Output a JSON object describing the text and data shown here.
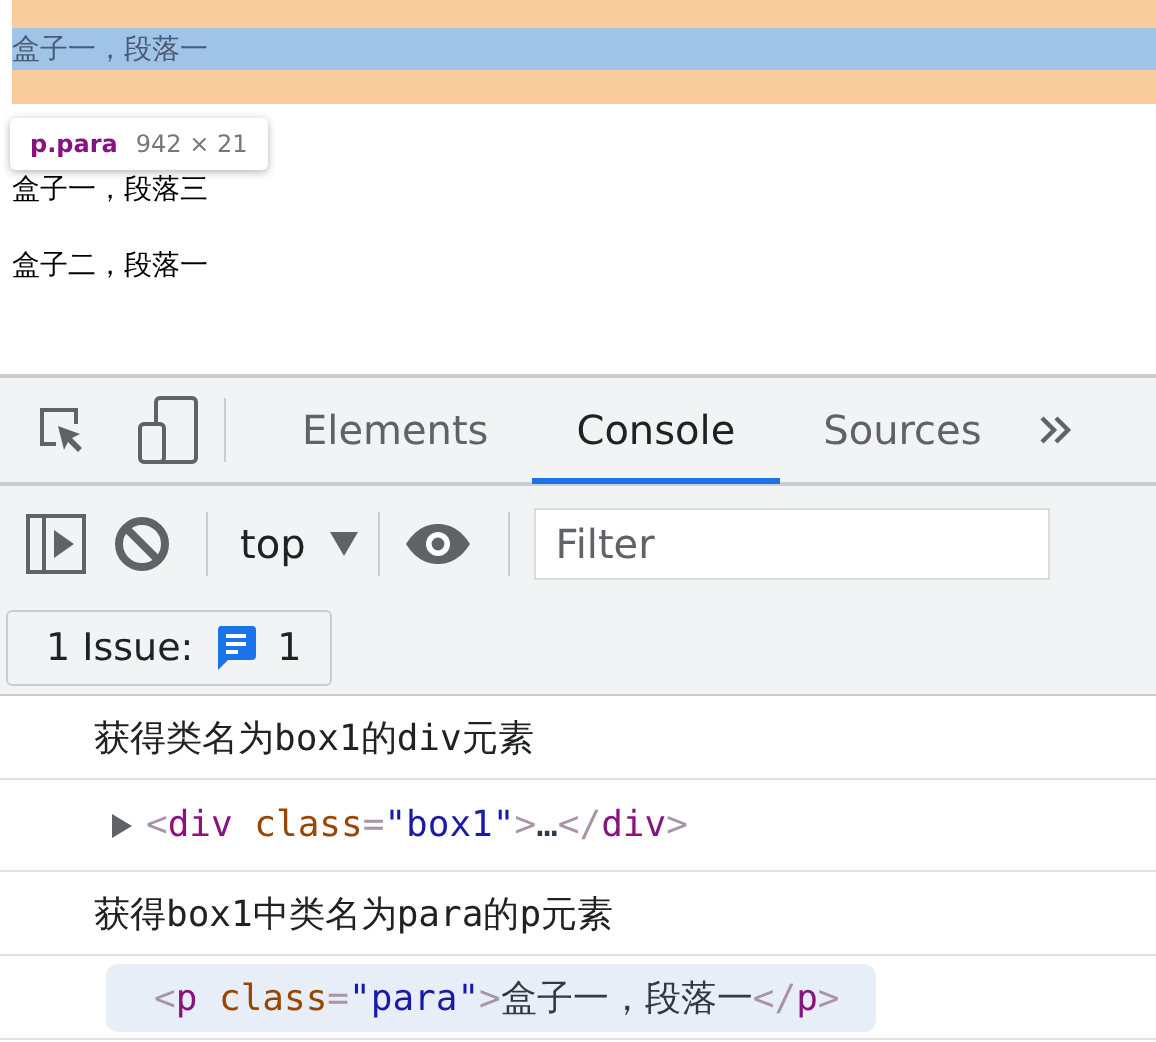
{
  "page": {
    "paragraphs": [
      {
        "text": "盒子一，段落一",
        "highlighted": true
      },
      {
        "text": "盒子一，段落三",
        "highlighted": false
      },
      {
        "text": "盒子二，段落一",
        "highlighted": false
      }
    ],
    "tooltip": {
      "selector": "p.para",
      "size": "942 × 21"
    }
  },
  "devtools": {
    "tabs": [
      {
        "label": "Elements",
        "selected": false
      },
      {
        "label": "Console",
        "selected": true
      },
      {
        "label": "Sources",
        "selected": false
      }
    ],
    "context": "top",
    "filter": {
      "placeholder": "Filter"
    },
    "issues": {
      "label": "1 Issue:",
      "count": "1"
    },
    "messages": [
      {
        "kind": "log",
        "text": "获得类名为box1的div元素"
      },
      {
        "kind": "element",
        "expandable": true,
        "highlighted": false,
        "tokens": [
          {
            "kind": "punct",
            "text": "<"
          },
          {
            "kind": "tag",
            "text": "div"
          },
          {
            "kind": "attr",
            "text": "class"
          },
          {
            "kind": "punct",
            "text": "="
          },
          {
            "kind": "value",
            "text": "\"box1\""
          },
          {
            "kind": "punct",
            "text": ">"
          },
          {
            "kind": "content",
            "text": "…"
          },
          {
            "kind": "punct",
            "text": "</"
          },
          {
            "kind": "tag",
            "text": "div"
          },
          {
            "kind": "punct",
            "text": ">"
          }
        ]
      },
      {
        "kind": "log",
        "text": "获得box1中类名为para的p元素"
      },
      {
        "kind": "element",
        "expandable": false,
        "highlighted": true,
        "tokens": [
          {
            "kind": "punct",
            "text": "<"
          },
          {
            "kind": "tag",
            "text": "p"
          },
          {
            "kind": "attr",
            "text": "class"
          },
          {
            "kind": "punct",
            "text": "="
          },
          {
            "kind": "value",
            "text": "\"para\""
          },
          {
            "kind": "punct",
            "text": ">"
          },
          {
            "kind": "content",
            "text": "盒子一，段落一"
          },
          {
            "kind": "punct",
            "text": "</"
          },
          {
            "kind": "tag",
            "text": "p"
          },
          {
            "kind": "punct",
            "text": ">"
          }
        ]
      }
    ]
  }
}
